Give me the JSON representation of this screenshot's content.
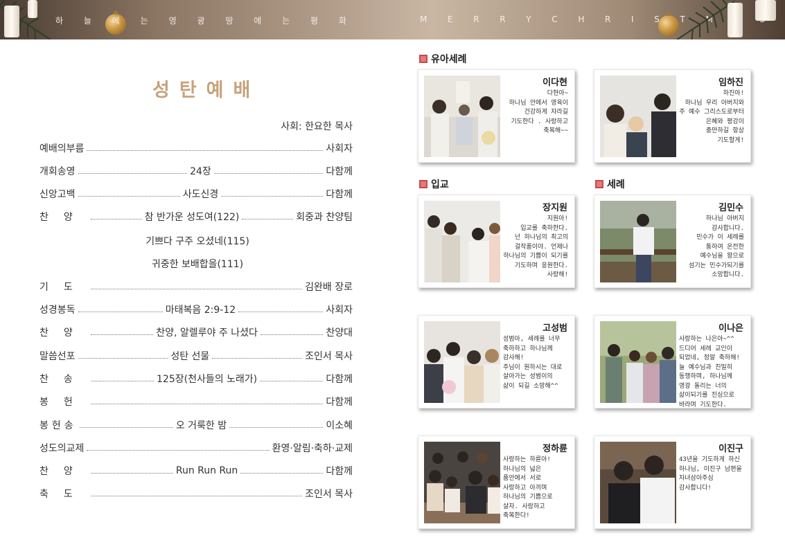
{
  "banner": {
    "left_chars": [
      "하",
      "늘",
      "에",
      "는",
      "영",
      "광",
      "땅",
      "에",
      "는",
      "평",
      "화"
    ],
    "right_chars": [
      "M",
      "E",
      "R",
      "R",
      "Y",
      "C",
      "H",
      "R",
      "I",
      "S",
      "T",
      "M",
      "A",
      "S"
    ]
  },
  "worship": {
    "title": "성탄예배",
    "presider": "사회: 한요한 목사",
    "items": [
      {
        "label": "예배의부름",
        "middle": "",
        "right": "사회자"
      },
      {
        "label": "개회송영",
        "middle": "24장",
        "right": "다함께"
      },
      {
        "label": "신앙고백",
        "middle": "사도신경",
        "right": "다함께"
      },
      {
        "label": "찬양",
        "middle": "참 반가운 성도여(122)",
        "right": "회중과 찬양팀"
      },
      {
        "label": "기도",
        "middle": "",
        "right": "김완배 장로"
      },
      {
        "label": "성경봉독",
        "middle": "마태복음 2:9-12",
        "right": "사회자"
      },
      {
        "label": "찬양",
        "middle": "찬양, 알렐루야 주 나셨다",
        "right": "찬양대"
      },
      {
        "label": "말씀선포",
        "middle": "성탄 선물",
        "right": "조인서 목사"
      },
      {
        "label": "찬송",
        "middle": "125장(천사들의 노래가)",
        "right": "다함께"
      },
      {
        "label": "봉헌",
        "middle": "",
        "right": "다함께"
      },
      {
        "label": "봉헌송",
        "middle": "오 거룩한 밤",
        "right": "이소혜"
      },
      {
        "label": "성도의교제",
        "middle": "",
        "right": "환영·알림·축하·교제"
      },
      {
        "label": "찬양",
        "middle": "Run Run Run",
        "right": "다함께"
      },
      {
        "label": "축도",
        "middle": "",
        "right": "조인서 목사"
      }
    ],
    "hymn_extra": [
      "기쁘다 구주 오셨네(115)",
      "귀중한 보배합을(111)"
    ]
  },
  "sections": {
    "infant_baptism": "유아세례",
    "confirmation": "입교",
    "baptism": "세례"
  },
  "cards": [
    {
      "name": "이다현",
      "message": "다현아~\n하나님 안에서 영육이\n건강하게 자라길\n기도한다 . 사랑하고\n축복해~~"
    },
    {
      "name": "임하진",
      "message": "하진아!\n하나님 우리 아버지와\n주 예수 그리스도로부터\n은혜와 평강이\n충만하길 항상\n기도할게!"
    },
    {
      "name": "장지원",
      "message": "지원아!\n입교를 축하한다.\n넌 하나님의 최고의\n걸작품이야. 언제나\n하나님의 기쁨이 되기를\n기도하며 응원한다.\n사랑해!"
    },
    {
      "name": "김민수",
      "message": "하나님 아버지\n감사합니다.\n민수가 이 세례를\n통하여 온전한\n예수님을 왕으로\n섬기는 민수가되기를\n소망합니다."
    },
    {
      "name": "고성범",
      "message": "성범아, 세례를 너무\n축하하고 하나님께\n감사해!\n주님이 원하시는 대로\n살아가는 성범이의\n삶이 되길 소망해^^"
    },
    {
      "name": "이나은",
      "message": "사랑하는 나은아~^^\n드디어 세례 교인이\n되었네, 정말 축하해!\n늘 예수님과 친밀히\n동행하며, 하나님께\n영광 돌리는 너의\n삶이되기를 진심으로\n바라며 기도한다."
    },
    {
      "name": "정하륜",
      "message": "사랑하는 하륜아!\n하나님의 넓은\n품안에서 서로\n사랑하고 아끼며\n하나님의 기쁨으로\n살자. 사랑하고\n축복한다!"
    },
    {
      "name": "이진구",
      "message": "43년을 기도하게 하신\n하나님, 이진구 남편을\n자녀삼아주심\n감사합니다!"
    }
  ],
  "colors": {
    "title": "#c7a27a",
    "section_mark": "#d95b5b",
    "banner_gold": "#c8963e"
  }
}
